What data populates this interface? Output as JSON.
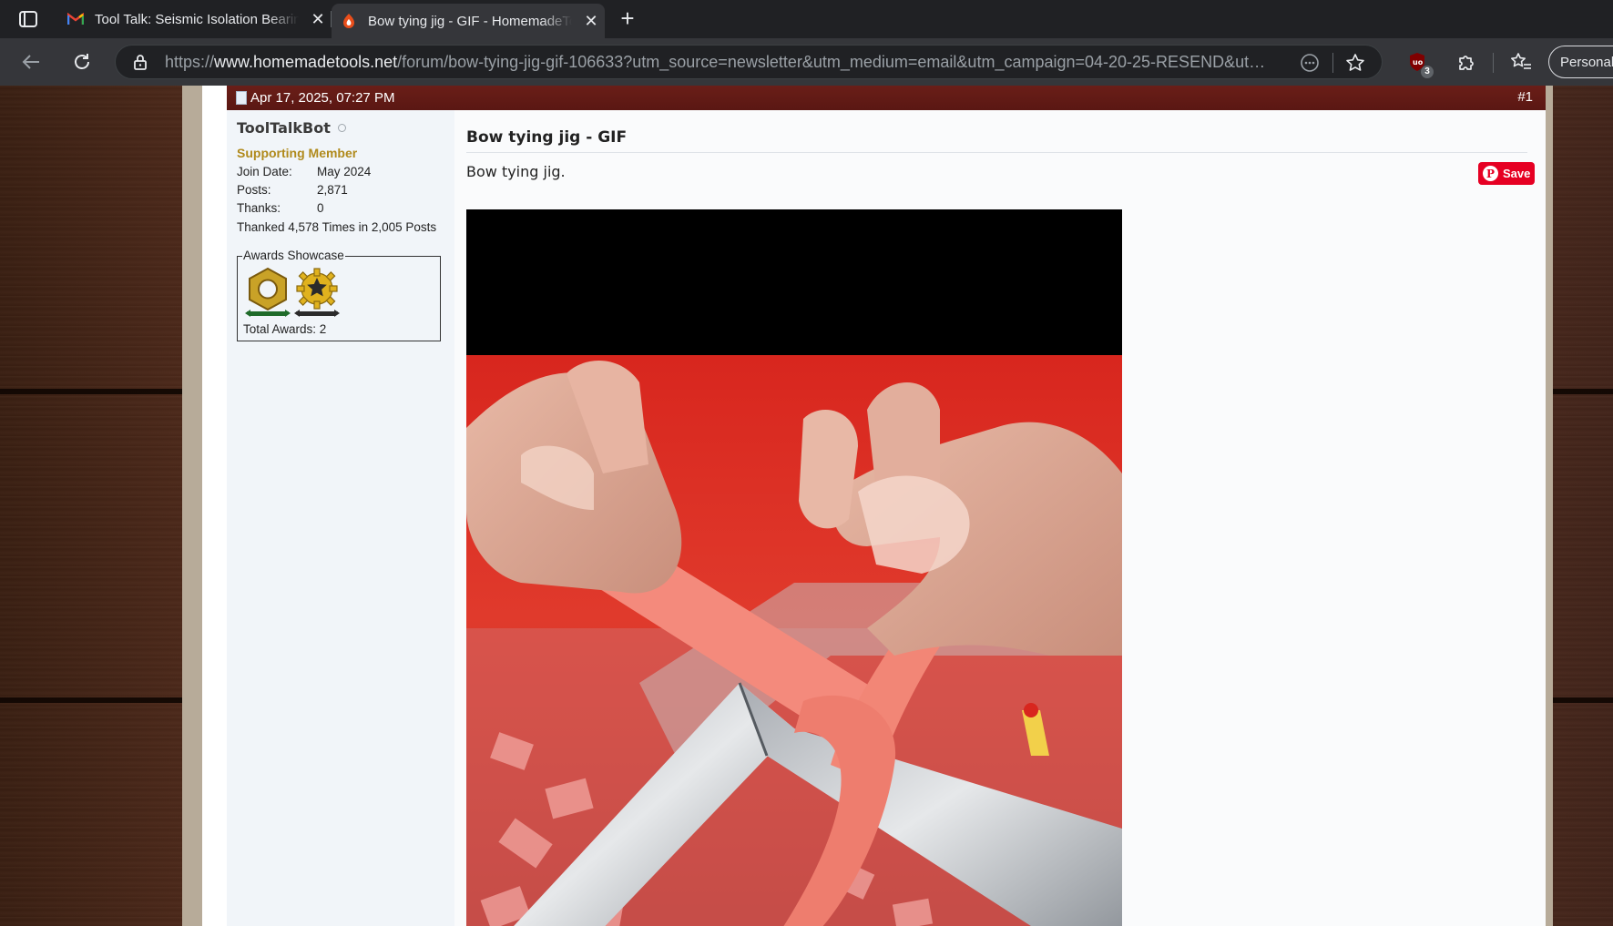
{
  "browser": {
    "tabs": [
      {
        "title": "Tool Talk: Seismic Isolation Bearin",
        "favicon": "gmail-icon",
        "active": false
      },
      {
        "title": "Bow tying jig - GIF - HomemadeTo",
        "favicon": "homemadetools-icon",
        "active": true
      }
    ],
    "url": {
      "scheme": "https://",
      "host": "www.homemadetools.net",
      "path": "/forum/bow-tying-jig-gif-106633?utm_source=newsletter&utm_medium=email&utm_campaign=04-20-25-RESEND&utm_..."
    },
    "extension_badge": "3",
    "profile_label": "Personal"
  },
  "post": {
    "date": "Apr 17, 2025, 07:27 PM",
    "number": "#1",
    "title": "Bow tying jig - GIF",
    "body": "Bow tying jig.",
    "pin_save_label": "Save"
  },
  "user": {
    "name": "ToolTalkBot",
    "rank": "Supporting Member",
    "stats": [
      {
        "label": "Join Date:",
        "value": "May 2024"
      },
      {
        "label": "Posts:",
        "value": "2,871"
      },
      {
        "label": "Thanks:",
        "value": "0"
      }
    ],
    "thanked": "Thanked 4,578 Times in 2,005 Posts",
    "awards_legend": "Awards Showcase",
    "awards_total": "Total Awards: 2"
  },
  "colors": {
    "post_header": "#5a1713",
    "rank": "#b08a1c",
    "pinterest": "#e60023"
  }
}
